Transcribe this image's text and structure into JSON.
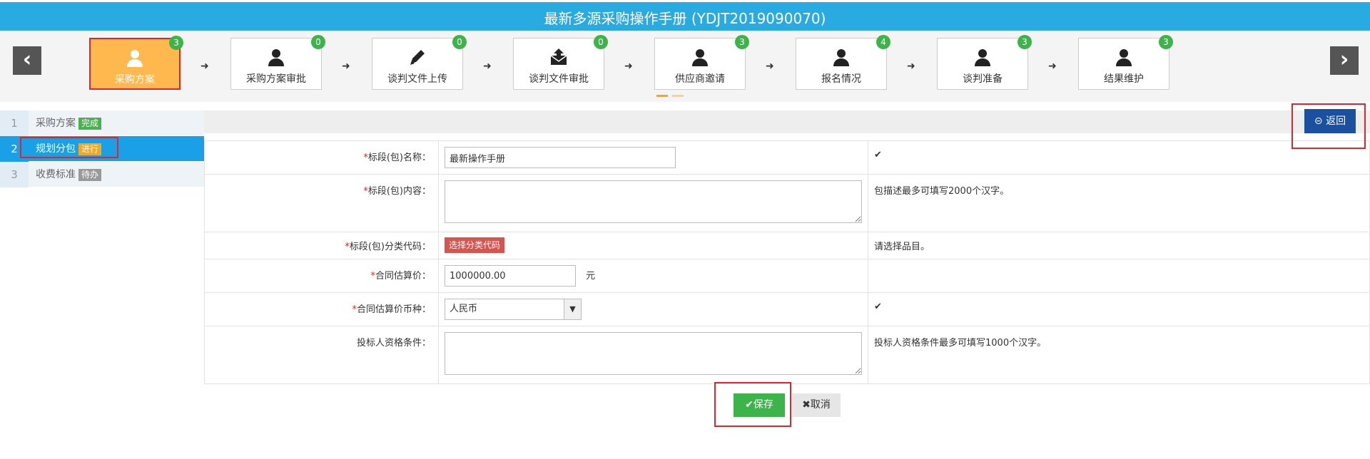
{
  "title": "最新多源采购操作手册 (YDJT2019090070)",
  "nav": {
    "prev_icon": "‹",
    "next_icon": "›"
  },
  "steps": [
    {
      "label": "采购方案",
      "badge": "3",
      "icon": "user-icon"
    },
    {
      "label": "采购方案审批",
      "badge": "0",
      "icon": "user-icon"
    },
    {
      "label": "谈判文件上传",
      "badge": "0",
      "icon": "pencil-icon"
    },
    {
      "label": "谈判文件审批",
      "badge": "0",
      "icon": "upload-envelope-icon"
    },
    {
      "label": "供应商邀请",
      "badge": "3",
      "icon": "user-icon"
    },
    {
      "label": "报名情况",
      "badge": "4",
      "icon": "user-icon"
    },
    {
      "label": "谈判准备",
      "badge": "3",
      "icon": "user-icon"
    },
    {
      "label": "结果维护",
      "badge": "3",
      "icon": "user-icon"
    }
  ],
  "step_arrow": "➜",
  "sidebar": [
    {
      "num": "1",
      "label": "采购方案",
      "tag": "完成"
    },
    {
      "num": "2",
      "label": "规划分包",
      "tag": "进行"
    },
    {
      "num": "3",
      "label": "收费标准",
      "tag": "待办"
    }
  ],
  "back_button": "返回",
  "form": {
    "required_mark": "*",
    "name": {
      "label": "标段(包)名称：",
      "value": "最新操作手册",
      "tip": "✔"
    },
    "content": {
      "label": "标段(包)内容：",
      "value": "",
      "tip": "包描述最多可填写2000个汉字。"
    },
    "code": {
      "label": "标段(包)分类代码：",
      "button": "选择分类代码",
      "tip": "请选择品目。"
    },
    "price": {
      "label": "合同估算价：",
      "value": "1000000.00",
      "unit": "元"
    },
    "currency": {
      "label": "合同估算价币种：",
      "value": "人民币",
      "tip": "✔"
    },
    "qualify": {
      "label": "投标人资格条件：",
      "value": "",
      "tip": "投标人资格条件最多可填写1000个汉字。"
    }
  },
  "save_button": "保存",
  "cancel_button": "取消",
  "colors": {
    "accent": "#29abe2",
    "active_step": "#ffb84d",
    "highlight": "#e0262b",
    "save": "#3cb44a",
    "back": "#1b4fa0"
  }
}
